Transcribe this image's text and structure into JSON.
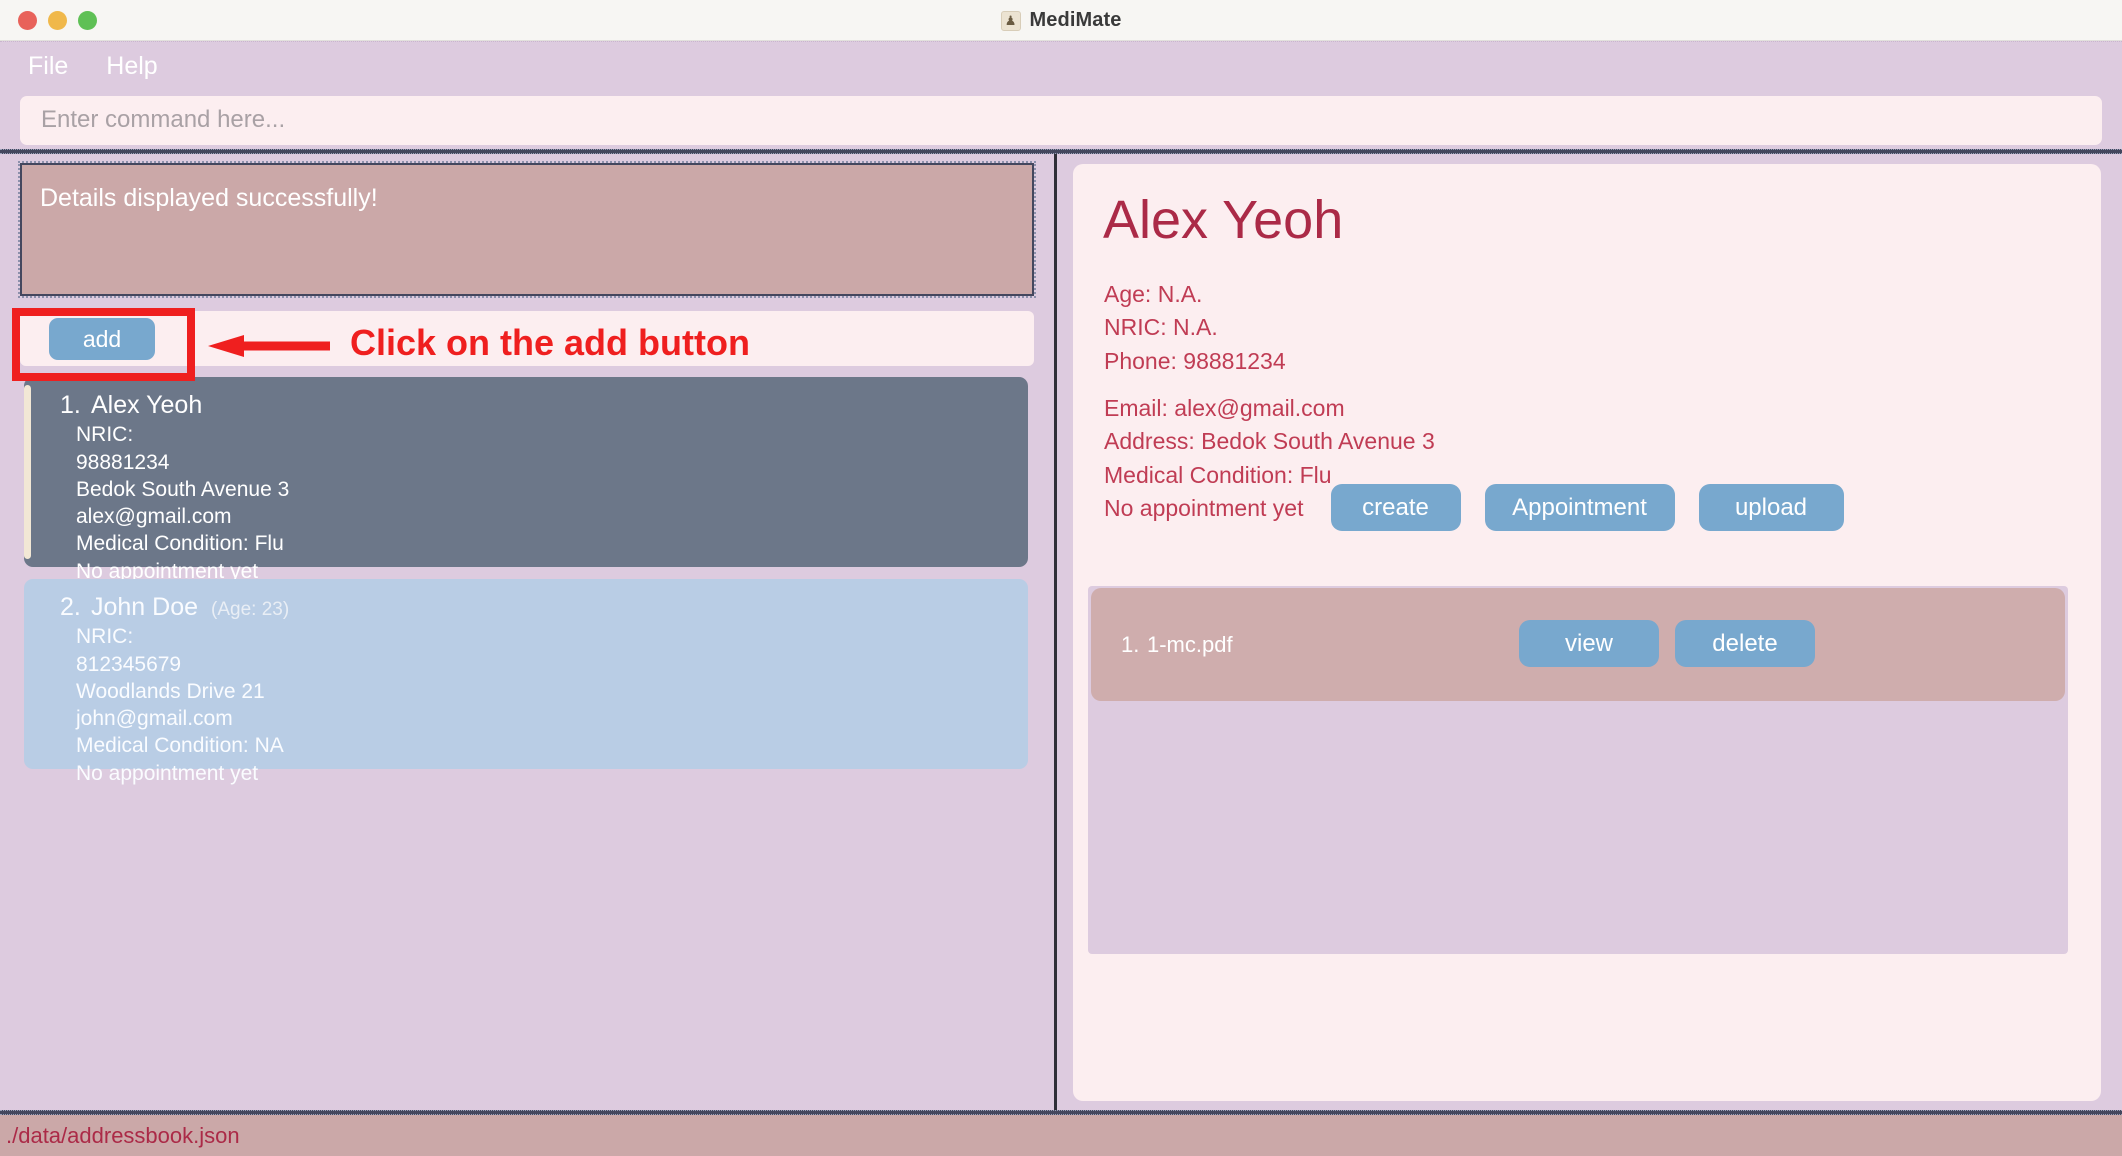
{
  "window": {
    "title": "MediMate",
    "app_icon": "person-badge-icon",
    "traffic_lights": [
      "close",
      "minimize",
      "maximize"
    ]
  },
  "menubar": {
    "items": [
      {
        "label": "File"
      },
      {
        "label": "Help"
      }
    ]
  },
  "command": {
    "placeholder": "Enter command here...",
    "value": ""
  },
  "result": {
    "message": "Details displayed successfully!"
  },
  "toolbar": {
    "add_label": "add"
  },
  "annotation": {
    "text": "Click on the add button",
    "color": "#ef1f1f",
    "arrow": "left-arrow-icon"
  },
  "person_list": [
    {
      "index": "1.",
      "name": "Alex Yeoh",
      "age_label": "",
      "lines": [
        "NRIC:",
        "98881234",
        "Bedok South Avenue 3",
        "alex@gmail.com",
        "Medical Condition: Flu",
        "No appointment yet"
      ],
      "selected": true
    },
    {
      "index": "2.",
      "name": "John Doe",
      "age_label": "(Age: 23)",
      "lines": [
        "NRIC:",
        "812345679",
        "Woodlands Drive 21",
        "john@gmail.com",
        "Medical Condition: NA",
        "No appointment yet"
      ],
      "selected": false
    }
  ],
  "detail": {
    "name": "Alex Yeoh",
    "age": "Age: N.A.",
    "nric": "NRIC: N.A.",
    "phone": "Phone: 98881234",
    "email": "Email: alex@gmail.com",
    "address": "Address: Bedok South Avenue 3",
    "condition": "Medical Condition: Flu",
    "appointment": "No appointment yet",
    "buttons": {
      "create": "create",
      "appointment": "Appointment",
      "upload": "upload"
    }
  },
  "files": [
    {
      "index": "1.",
      "name": "1-mc.pdf",
      "view_label": "view",
      "delete_label": "delete"
    }
  ],
  "statusbar": {
    "path": "./data/addressbook.json"
  },
  "colors": {
    "accent_lavender": "#ddcbdf",
    "panel_pink": "#fceef0",
    "button_blue": "#78a8ce",
    "result_mauve": "#cba8a8",
    "selected_slate": "#6c7789",
    "unselected_blue": "#b9cde5",
    "text_crimson": "#ab2a47",
    "annotation_red": "#ef1f1f"
  }
}
